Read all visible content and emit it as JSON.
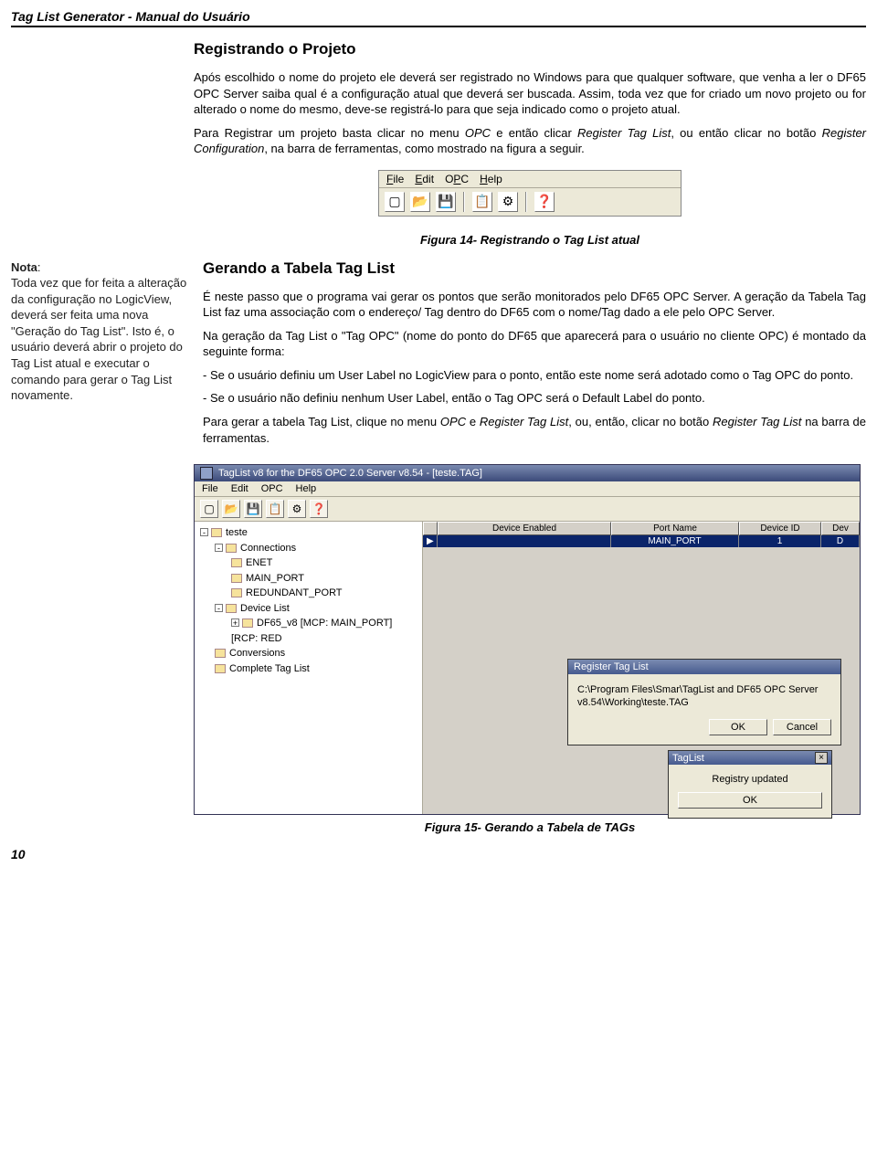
{
  "header": {
    "title": "Tag List Generator - Manual do Usuário"
  },
  "section1": {
    "heading": "Registrando o Projeto",
    "para1": "Após escolhido o nome do projeto ele deverá ser registrado no Windows para que qualquer software, que venha a ler o DF65 OPC Server saiba qual é a configuração atual que deverá ser buscada. Assim, toda vez que for criado um novo projeto ou for alterado o nome do mesmo, deve-se registrá-lo para que seja indicado como o projeto atual.",
    "para2_pre": "Para Registrar um projeto basta clicar no menu ",
    "para2_i1": "OPC",
    "para2_mid1": " e então clicar ",
    "para2_i2": "Register Tag List",
    "para2_mid2": ", ou então clicar no botão ",
    "para2_i3": "Register Configuration",
    "para2_end": ", na barra de ferramentas, como mostrado na figura a seguir."
  },
  "toolbar_small": {
    "menus": {
      "file": "File",
      "edit": "Edit",
      "opc": "OPC",
      "help": "Help"
    },
    "icons": [
      "new",
      "open",
      "save",
      "taglist",
      "register",
      "help"
    ]
  },
  "fig14": "Figura 14- Registrando o Tag List atual",
  "sidebar": {
    "label": "Nota",
    "text": "Toda vez que for feita a alteração da configuração no LogicView, deverá ser feita uma nova \"Geração do Tag List\". Isto é, o usuário deverá abrir o projeto do Tag List atual e executar o comando para gerar o Tag List novamente."
  },
  "section2": {
    "heading": "Gerando a Tabela Tag List",
    "p1": "É neste passo que o programa vai gerar os pontos que serão monitorados pelo DF65 OPC Server. A geração da Tabela Tag List faz uma associação com o endereço/ Tag dentro do DF65 com o nome/Tag dado a ele pelo OPC Server.",
    "p2": "Na geração da Tag List o \"Tag OPC\" (nome do ponto do DF65 que aparecerá para o usuário no cliente OPC) é montado da seguinte forma:",
    "p3": "- Se o usuário definiu um User Label no LogicView para o ponto, então este nome será adotado como o Tag OPC do ponto.",
    "p4": "- Se o usuário não definiu nenhum User Label, então o Tag OPC será o Default Label do ponto.",
    "p5_pre": "Para gerar a tabela Tag List, clique no menu ",
    "p5_i1": "OPC",
    "p5_mid1": " e ",
    "p5_i2": "Register Tag List",
    "p5_mid2": ", ou, então, clicar no botão ",
    "p5_i3": "Register Tag List",
    "p5_end": " na barra de ferramentas."
  },
  "appwindow": {
    "title": "TagList v8 for the DF65 OPC 2.0 Server v8.54 - [teste.TAG]",
    "menus": {
      "file": "File",
      "edit": "Edit",
      "opc": "OPC",
      "help": "Help"
    },
    "tree": {
      "root": "teste",
      "connections": "Connections",
      "enet": "ENET",
      "main_port": "MAIN_PORT",
      "redundant_port": "REDUNDANT_PORT",
      "device_list": "Device List",
      "df65": "DF65_v8 [MCP: MAIN_PORT] [RCP: RED",
      "conversions": "Conversions",
      "complete": "Complete Tag List"
    },
    "grid": {
      "h_enabled": "Device Enabled",
      "h_port": "Port Name",
      "h_devid": "Device ID",
      "h_dev": "Dev",
      "row_port": "MAIN_PORT",
      "row_id": "1",
      "row_dev": "D"
    },
    "dialog": {
      "title": "Register Tag List",
      "text": "C:\\Program Files\\Smar\\TagList and DF65 OPC Server v8.54\\Working\\teste.TAG",
      "ok": "OK",
      "cancel": "Cancel"
    },
    "msgbox": {
      "title": "TagList",
      "text": "Registry updated",
      "ok": "OK"
    }
  },
  "fig15": "Figura 15- Gerando a Tabela de TAGs",
  "pagenum": "10"
}
